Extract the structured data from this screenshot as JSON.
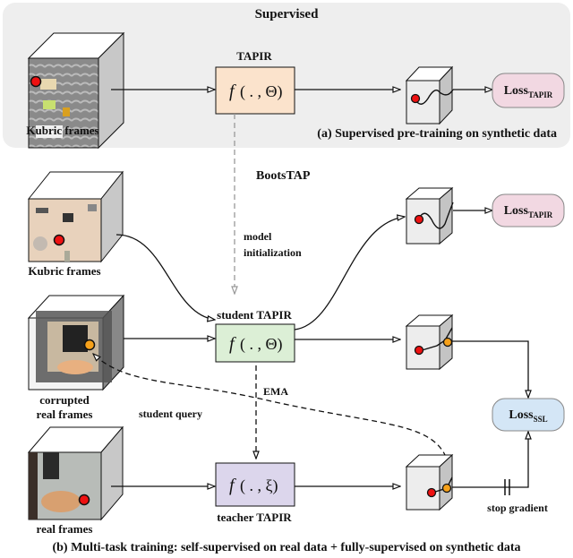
{
  "top_panel": {
    "title": "Supervised",
    "input_label": "Kubric frames",
    "model_label": "TAPIR",
    "model_fn": "f",
    "model_args": "( . , Θ)",
    "loss_main": "Loss",
    "loss_sub": "TAPIR",
    "caption": "(a)  Supervised pre-training on synthetic data"
  },
  "bottom_panel": {
    "title": "BootsTAP",
    "init_label_1": "model",
    "init_label_2": "initialization",
    "kubric_label": "Kubric frames",
    "corrupted_label_1": "corrupted",
    "corrupted_label_2": "real frames",
    "real_label": "real frames",
    "student_label": "student TAPIR",
    "student_fn": "f",
    "student_args": "( . , Θ)",
    "teacher_label": "teacher TAPIR",
    "teacher_fn": "f",
    "teacher_args": "( . , ξ)",
    "ema_label": "EMA",
    "student_query_label": "student query",
    "stop_gradient_label": "stop gradient",
    "loss_tapir_main": "Loss",
    "loss_tapir_sub": "TAPIR",
    "loss_ssl_main": "Loss",
    "loss_ssl_sub": "SSL",
    "caption": "(b)  Multi-task training: self-supervised on real data + fully-supervised on synthetic data"
  },
  "colors": {
    "panel_bg": "#eeeeee",
    "tapir_box": "#fbe3cc",
    "student_box": "#dcefd6",
    "teacher_box": "#dcd6ec",
    "loss_tapir": "#f2d8e2",
    "loss_ssl": "#d4e6f6",
    "query_red": "#ee1111",
    "query_orange": "#f6a11a"
  }
}
